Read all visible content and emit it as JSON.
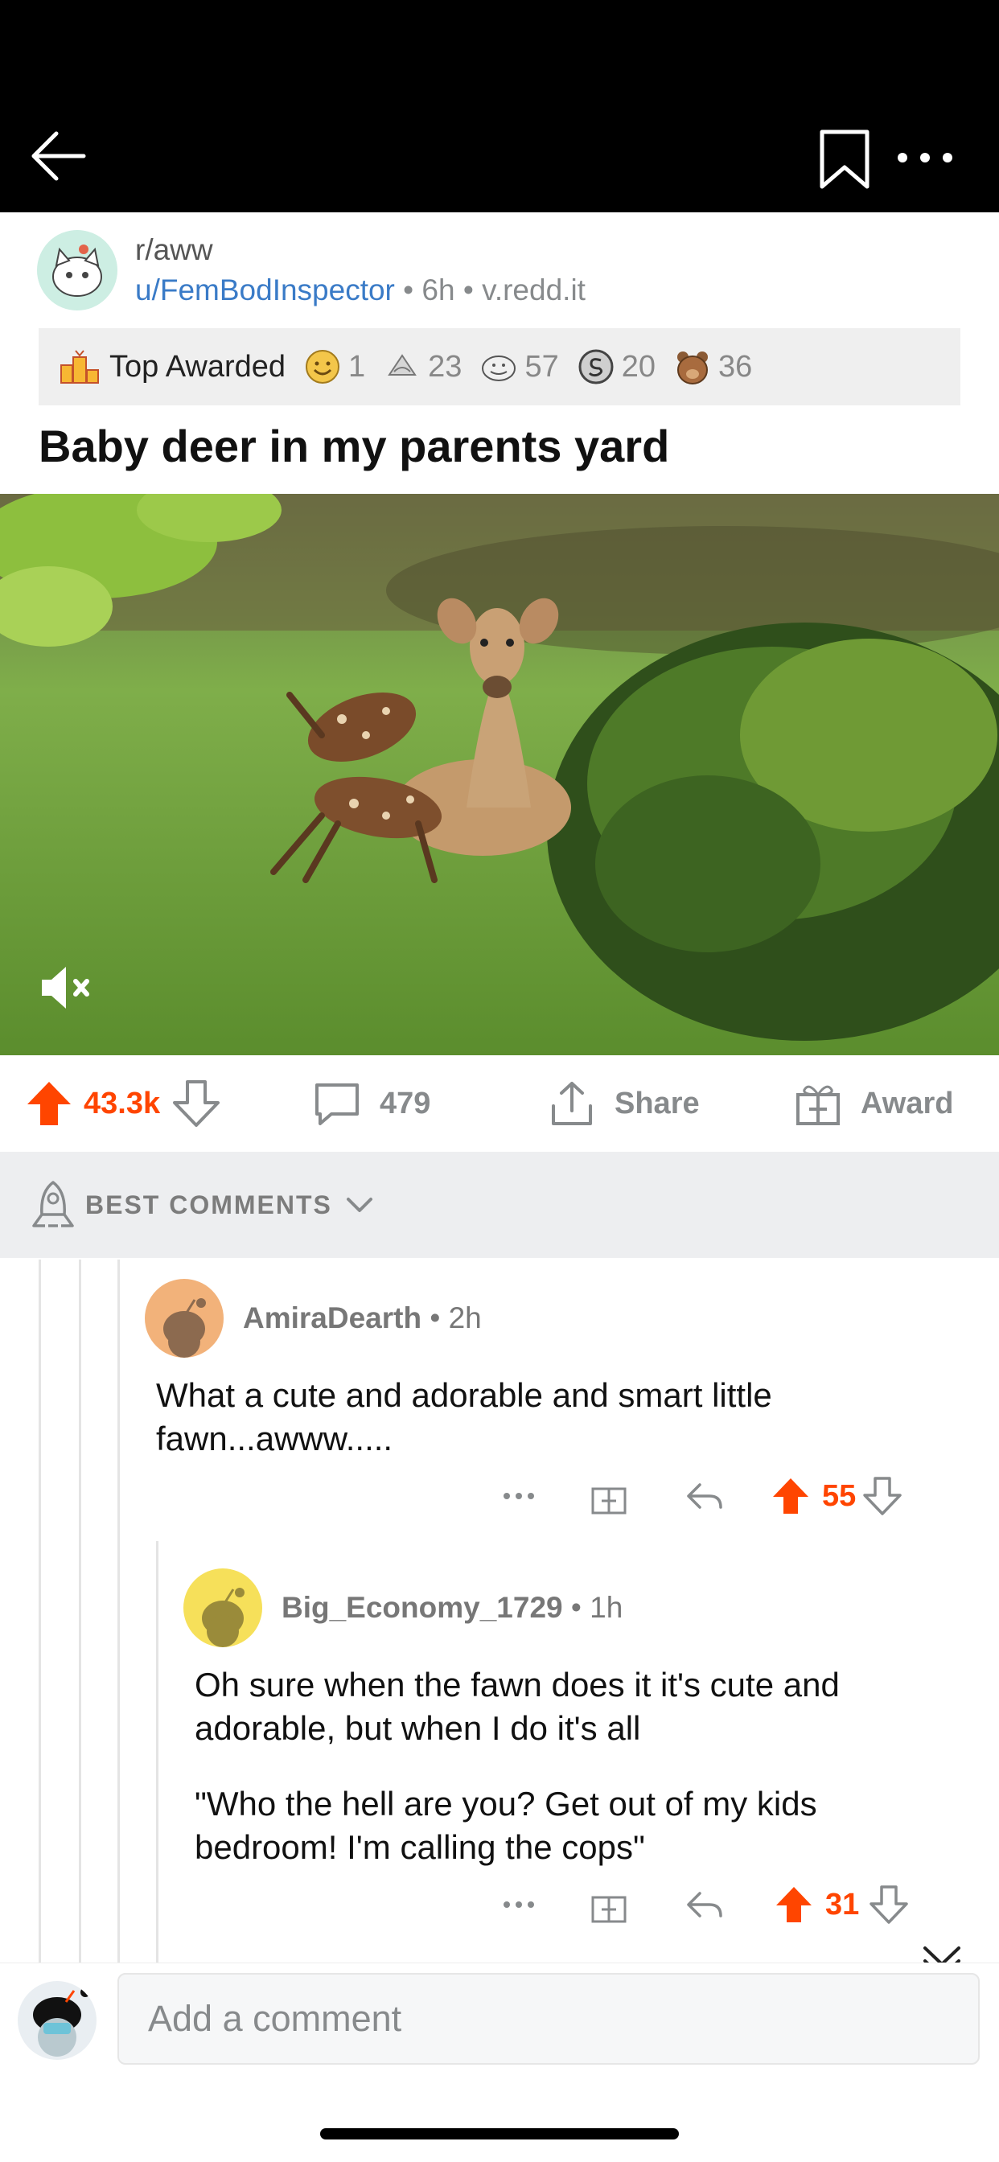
{
  "topbar": {
    "back_icon": "arrow-left-icon",
    "bookmark_icon": "bookmark-icon",
    "more_icon": "ellipsis-icon"
  },
  "post": {
    "subreddit": "r/aww",
    "author": "u/FemBodInspector",
    "age": "6h",
    "domain": "v.redd.it",
    "awards_label": "Top Awarded",
    "awards": [
      {
        "icon": "wholesome-award-icon",
        "count": "1"
      },
      {
        "icon": "helpful-award-icon",
        "count": "23"
      },
      {
        "icon": "wholesome-seal-icon",
        "count": "57"
      },
      {
        "icon": "silver-award-icon",
        "count": "20"
      },
      {
        "icon": "bear-award-icon",
        "count": "36"
      }
    ],
    "title": "Baby deer in my parents yard",
    "score": "43.3k",
    "comments": "479",
    "share_label": "Share",
    "award_label": "Award"
  },
  "sort": {
    "label": "BEST COMMENTS"
  },
  "comments": [
    {
      "author": "AmiraDearth",
      "age": "2h",
      "text": "What a cute and adorable and smart little fawn...awww.....",
      "score": "55"
    },
    {
      "author": "Big_Economy_1729",
      "age": "1h",
      "text1": "Oh sure when the fawn does it it's cute and adorable, but when I do it's all",
      "text2": "\"Who the hell are you?  Get out of my kids bedroom!  I'm calling the cops\"",
      "score": "31"
    }
  ],
  "composer": {
    "placeholder": "Add a comment"
  },
  "colors": {
    "upvote": "#ff4500",
    "link": "#3a7bc7",
    "muted": "#878a8c"
  }
}
